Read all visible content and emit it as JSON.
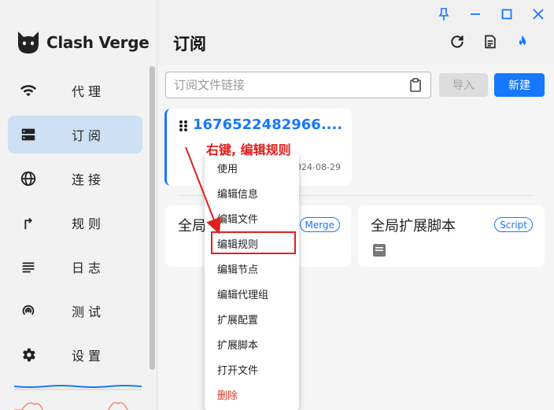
{
  "app": {
    "name": "Clash Verge"
  },
  "sidebar": {
    "items": [
      {
        "label": "代理",
        "icon": "wifi-icon"
      },
      {
        "label": "订阅",
        "icon": "server-icon",
        "active": true
      },
      {
        "label": "连接",
        "icon": "globe-icon"
      },
      {
        "label": "规则",
        "icon": "route-icon"
      },
      {
        "label": "日志",
        "icon": "list-icon"
      },
      {
        "label": "测试",
        "icon": "signal-icon"
      },
      {
        "label": "设置",
        "icon": "gear-icon"
      }
    ]
  },
  "page": {
    "title": "订阅"
  },
  "toolbar": {
    "url_placeholder": "订阅文件链接",
    "import_label": "导入",
    "new_label": "新建"
  },
  "subscription": {
    "name": "1676522482966....",
    "date": "2024-08-29"
  },
  "profiles": [
    {
      "title": "全局扩展覆写配置",
      "tag": "Merge"
    },
    {
      "title": "全局扩展脚本",
      "tag": "Script"
    }
  ],
  "context_menu": {
    "items": [
      "使用",
      "编辑信息",
      "编辑文件",
      "编辑规则",
      "编辑节点",
      "编辑代理组",
      "扩展配置",
      "扩展脚本",
      "打开文件",
      "删除"
    ]
  },
  "annotation": {
    "text": "右键, 编辑规则"
  },
  "colors": {
    "accent": "#1677ff",
    "active_nav": "#cde0f4",
    "danger": "#d9362b",
    "annotation": "#e02020"
  }
}
